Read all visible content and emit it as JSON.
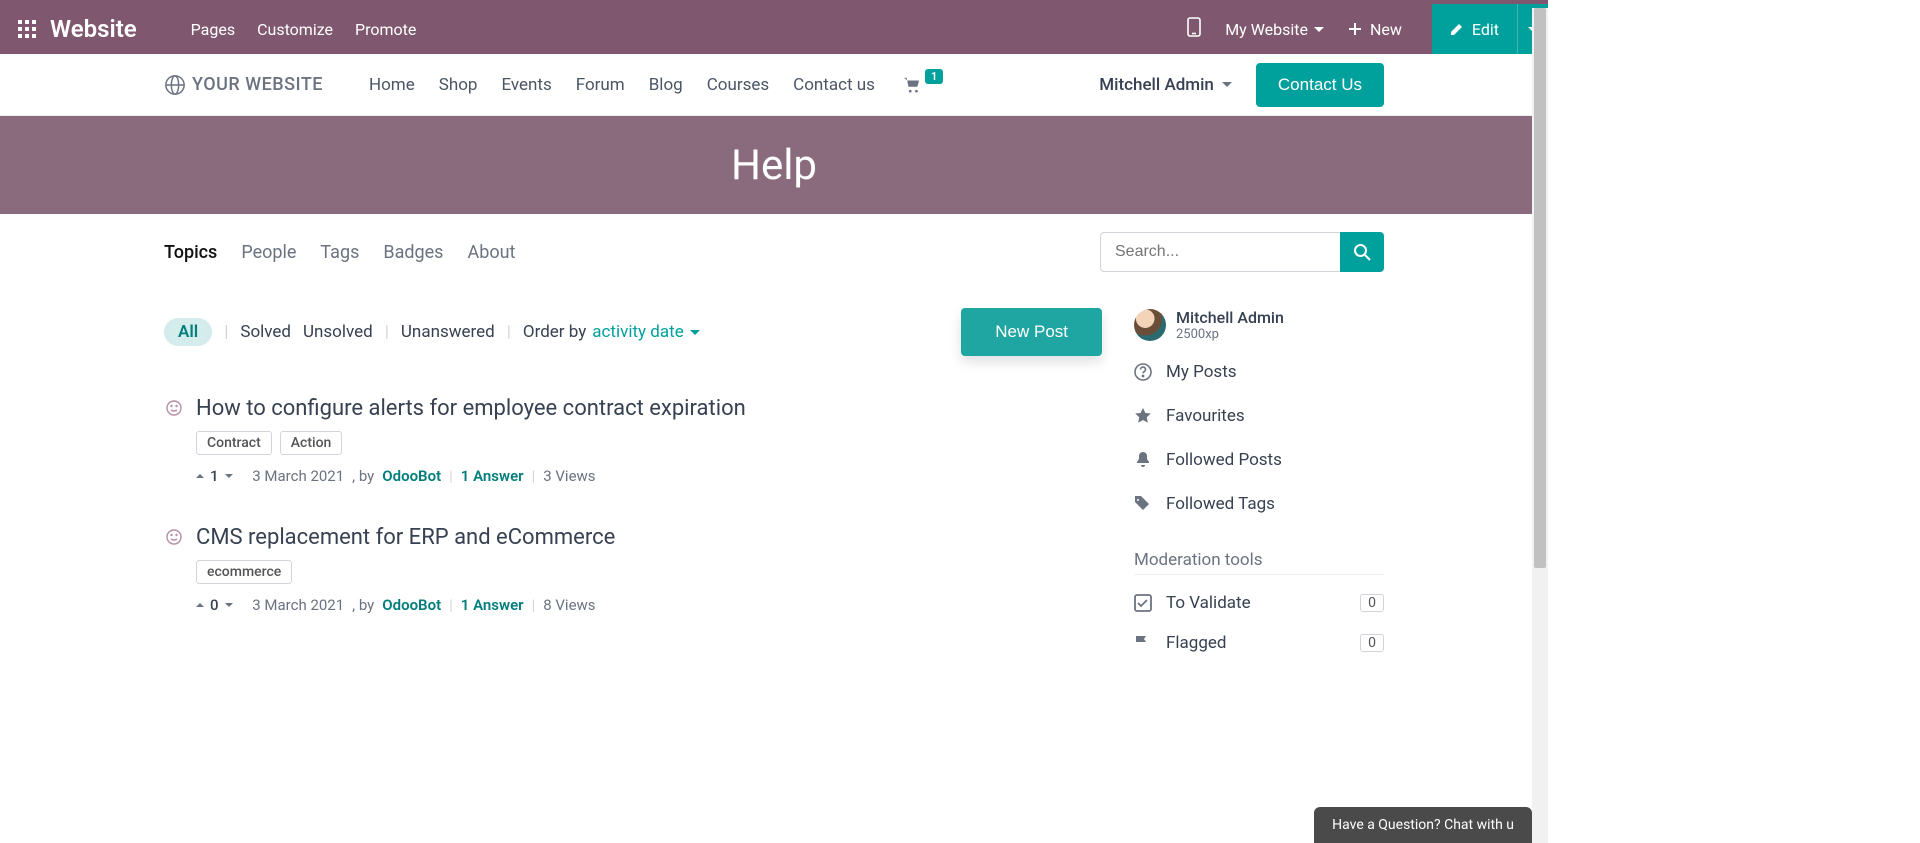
{
  "topbar": {
    "brand": "Website",
    "menu": [
      "Pages",
      "Customize",
      "Promote"
    ],
    "my_website": "My Website",
    "new": "New",
    "edit": "Edit"
  },
  "sitebar": {
    "logo_text": "YOUR WEBSITE",
    "nav": [
      "Home",
      "Shop",
      "Events",
      "Forum",
      "Blog",
      "Courses",
      "Contact us"
    ],
    "cart_count": "1",
    "user": "Mitchell Admin",
    "contact_btn": "Contact Us"
  },
  "hero": {
    "title": "Help"
  },
  "forum_tabs": [
    "Topics",
    "People",
    "Tags",
    "Badges",
    "About"
  ],
  "search": {
    "placeholder": "Search..."
  },
  "filters": {
    "all": "All",
    "solved": "Solved",
    "unsolved": "Unsolved",
    "unanswered": "Unanswered",
    "order_label": "Order by",
    "order_value": "activity date"
  },
  "new_post": "New Post",
  "topics": [
    {
      "title": "How to configure alerts for employee contract expiration",
      "tags": [
        "Contract",
        "Action"
      ],
      "votes": "1",
      "date": "3 March 2021",
      "by": ", by",
      "author": "OdooBot",
      "answers": "1 Answer",
      "views": "3 Views"
    },
    {
      "title": "CMS replacement for ERP and eCommerce",
      "tags": [
        "ecommerce"
      ],
      "votes": "0",
      "date": "3 March 2021",
      "by": ", by",
      "author": "OdooBot",
      "answers": "1 Answer",
      "views": "8 Views"
    }
  ],
  "sidebar": {
    "user_name": "Mitchell Admin",
    "xp": "2500xp",
    "links": [
      "My Posts",
      "Favourites",
      "Followed Posts",
      "Followed Tags"
    ],
    "moderation_header": "Moderation tools",
    "mod": [
      {
        "label": "To Validate",
        "count": "0"
      },
      {
        "label": "Flagged",
        "count": "0"
      }
    ]
  },
  "chat": "Have a Question? Chat with u"
}
